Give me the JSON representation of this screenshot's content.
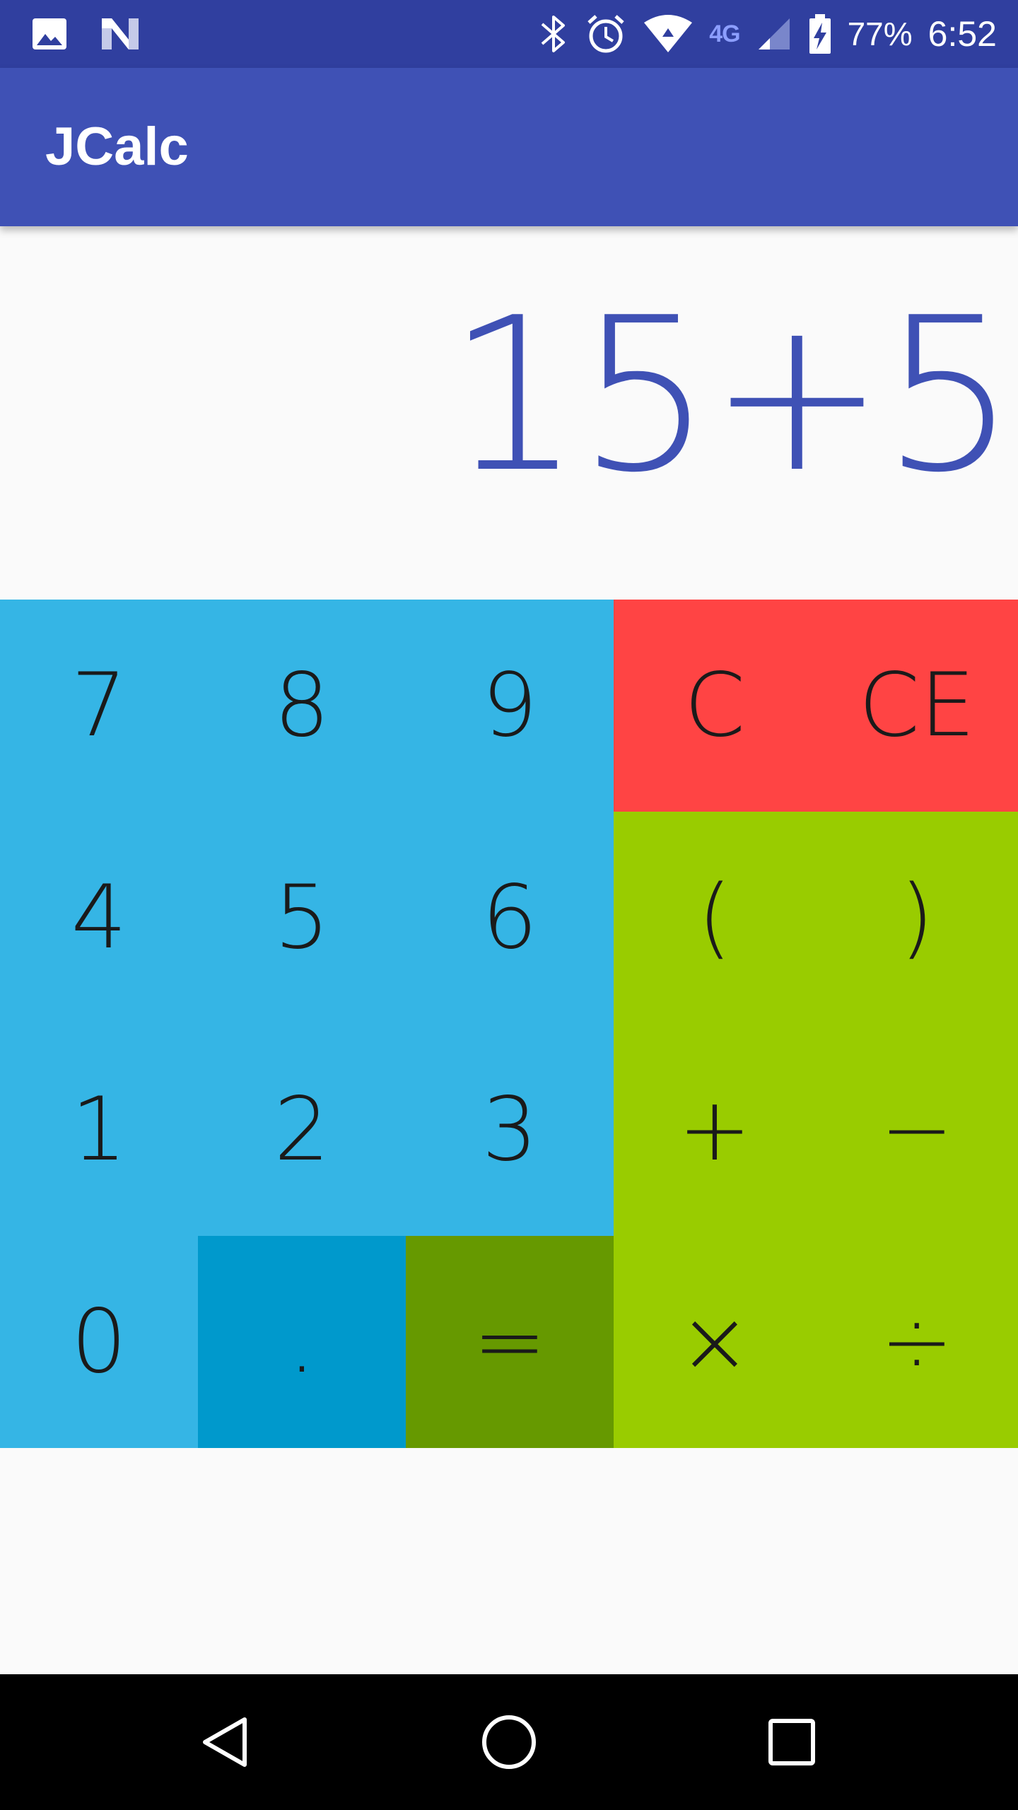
{
  "status_bar": {
    "left_icons": [
      "image-icon",
      "n-notification-icon"
    ],
    "right_icons": [
      "bluetooth-icon",
      "alarm-icon",
      "wifi-icon",
      "lte-icon",
      "signal-icon",
      "battery-charging-icon"
    ],
    "network_label": "4G",
    "battery_percent": "77%",
    "time": "6:52"
  },
  "app_bar": {
    "title": "JCalc"
  },
  "display": {
    "expression": "15+5"
  },
  "keypad": {
    "keys": [
      {
        "label": "7",
        "color": "#35b5e5"
      },
      {
        "label": "8",
        "color": "#35b5e5"
      },
      {
        "label": "9",
        "color": "#35b5e5"
      },
      {
        "label": "C",
        "color": "#ff4444"
      },
      {
        "label": "CE",
        "color": "#ff4444"
      },
      {
        "label": "4",
        "color": "#35b5e5"
      },
      {
        "label": "5",
        "color": "#35b5e5"
      },
      {
        "label": "6",
        "color": "#35b5e5"
      },
      {
        "label": "(",
        "color": "#99cc00"
      },
      {
        "label": ")",
        "color": "#99cc00"
      },
      {
        "label": "1",
        "color": "#35b5e5"
      },
      {
        "label": "2",
        "color": "#35b5e5"
      },
      {
        "label": "3",
        "color": "#35b5e5"
      },
      {
        "label": "+",
        "color": "#99cc00"
      },
      {
        "label": "−",
        "color": "#99cc00"
      },
      {
        "label": "0",
        "color": "#35b5e5"
      },
      {
        "label": ".",
        "color": "#0099cc"
      },
      {
        "label": "=",
        "color": "#669900"
      },
      {
        "label": "×",
        "color": "#99cc00"
      },
      {
        "label": "÷",
        "color": "#99cc00"
      }
    ]
  },
  "nav_bar": {
    "buttons": [
      "back-icon",
      "home-icon",
      "recents-icon"
    ]
  },
  "colors": {
    "status_bar": "#303f9f",
    "app_bar": "#3f51b5",
    "expression_text": "#3f51b5",
    "background": "#fafafa"
  }
}
